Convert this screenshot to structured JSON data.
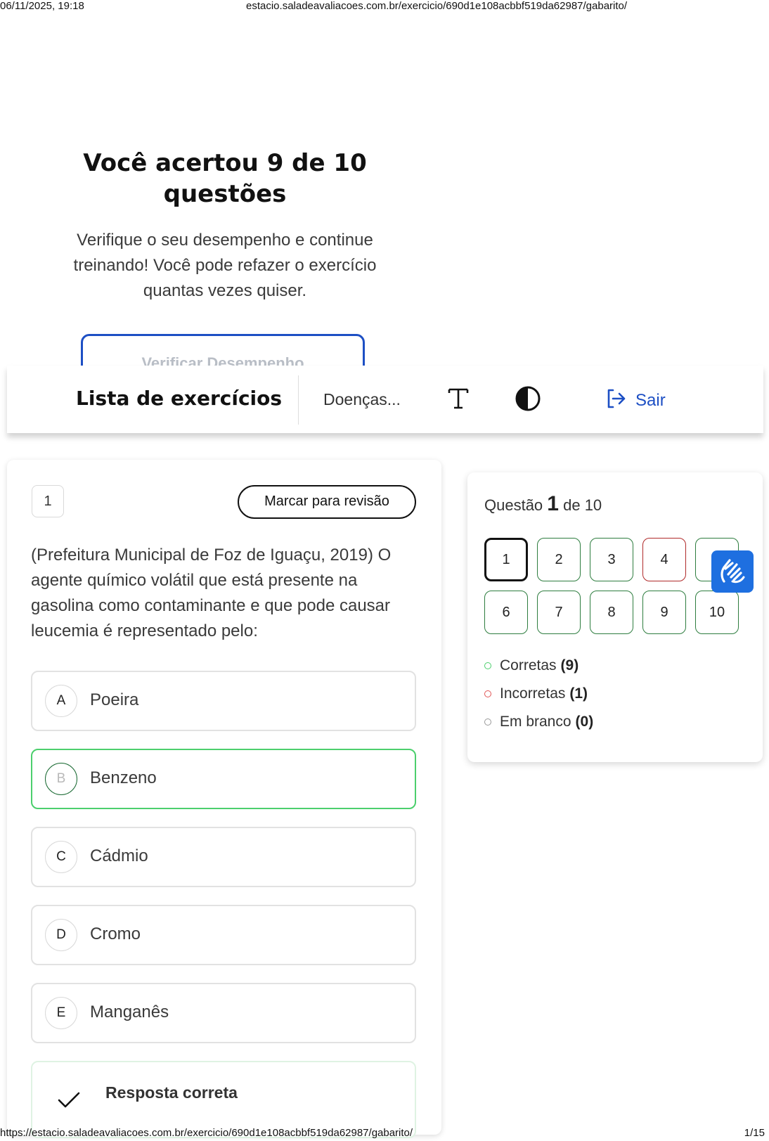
{
  "print": {
    "datetime": "06/11/2025, 19:18",
    "header_url": "estacio.saladeavaliacoes.com.br/exercicio/690d1e108acbbf519da62987/gabarito/",
    "footer_url": "https://estacio.saladeavaliacoes.com.br/exercicio/690d1e108acbbf519da62987/gabarito/",
    "page": "1/15"
  },
  "hero": {
    "title": "Você acertou 9 de 10 questões",
    "text": "Verifique o seu desempenho e continue treinando! Você pode refazer o exercício quantas vezes quiser.",
    "button": "Verificar Desempenho"
  },
  "topbar": {
    "title": "Lista de exercícios",
    "subject": "Doenças...",
    "font_icon": "text-size-icon",
    "contrast_icon": "contrast-icon",
    "exit_label": "Sair",
    "accent": "#1d4fc4"
  },
  "question": {
    "number": "1",
    "review_label": "Marcar para revisão",
    "text": "(Prefeitura Municipal de Foz de Iguaçu, 2019) O agente químico volátil que está presente na gasolina como contaminante e que pode causar leucemia é representado pelo:",
    "options": [
      {
        "letter": "A",
        "text": "Poeira",
        "correct": false
      },
      {
        "letter": "B",
        "text": "Benzeno",
        "correct": true
      },
      {
        "letter": "C",
        "text": "Cádmio",
        "correct": false
      },
      {
        "letter": "D",
        "text": "Cromo",
        "correct": false
      },
      {
        "letter": "E",
        "text": "Manganês",
        "correct": false
      }
    ],
    "feedback_title": "Resposta correta"
  },
  "panel": {
    "title_prefix": "Questão",
    "current": "1",
    "title_suffix": "de 10",
    "buttons": [
      {
        "label": "1",
        "status": "current"
      },
      {
        "label": "2",
        "status": "correct"
      },
      {
        "label": "3",
        "status": "correct"
      },
      {
        "label": "4",
        "status": "wrong"
      },
      {
        "label": "5",
        "status": "correct"
      },
      {
        "label": "6",
        "status": "correct"
      },
      {
        "label": "7",
        "status": "correct"
      },
      {
        "label": "8",
        "status": "correct"
      },
      {
        "label": "9",
        "status": "correct"
      },
      {
        "label": "10",
        "status": "correct"
      }
    ],
    "legend": [
      {
        "label": "Corretas",
        "count": "(9)",
        "color": "#4ccf6d"
      },
      {
        "label": "Incorretas",
        "count": "(1)",
        "color": "#e05555"
      },
      {
        "label": "Em branco",
        "count": "(0)",
        "color": "#999999"
      }
    ]
  },
  "accessibility": {
    "icon": "sign-language-icon",
    "color": "#1e6fe0"
  }
}
